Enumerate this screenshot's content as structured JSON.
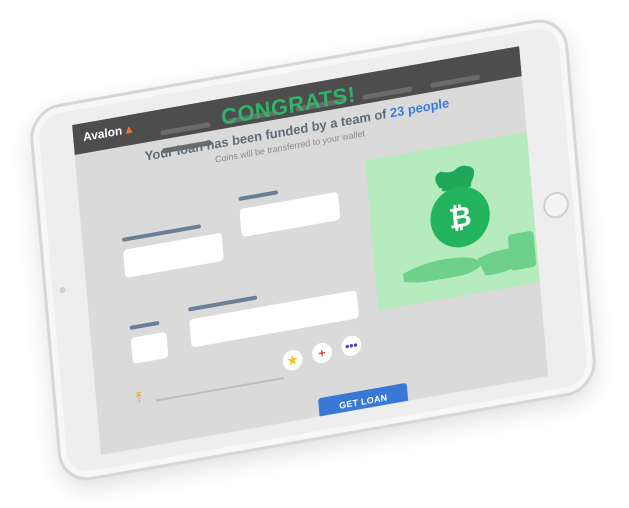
{
  "app": {
    "logo_text": "Avalon",
    "nav_links": [
      "",
      "",
      "",
      "",
      "",
      ""
    ]
  },
  "hero": {
    "title": "CONGRATS!",
    "subtitle_prefix": "Your loan has been funded by a team of",
    "subtitle_count": "23 people",
    "note": "Coins will be transferred to your wallet"
  },
  "form": {
    "fields": [
      "",
      "",
      "",
      "",
      ""
    ],
    "actions": [
      {
        "icon": "star-icon",
        "color": "#f3c623"
      },
      {
        "icon": "plus-icon",
        "color": "#e23b3b"
      },
      {
        "icon": "ellipsis-icon",
        "color": "#5a35c7"
      }
    ]
  },
  "illustration": {
    "icon": "money-bag-bitcoin-icon",
    "symbol": "₿"
  },
  "cta": {
    "label": "GET LOAN"
  },
  "colors": {
    "accent_green": "#2fb36a",
    "accent_blue": "#3b7dd8",
    "cta_blue": "#3a78d6",
    "navbar": "#4d4d4d",
    "illustration_bg": "#b6ebbe"
  }
}
